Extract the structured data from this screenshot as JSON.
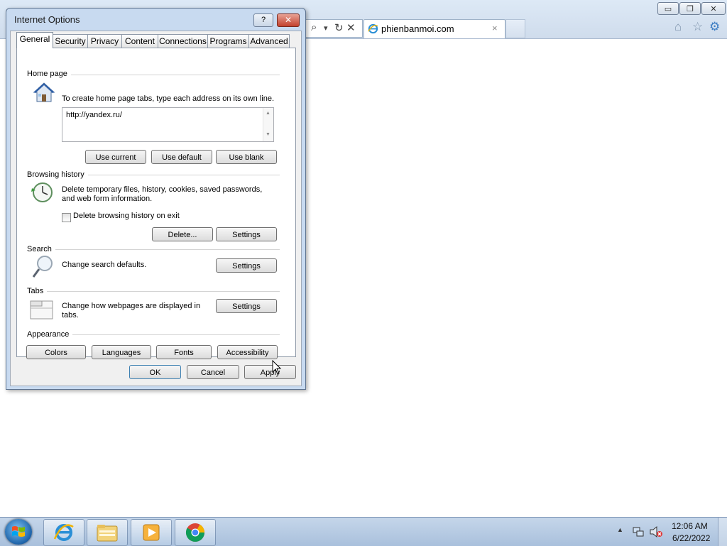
{
  "browser": {
    "tab_title": "phienbanmoi.com",
    "tab_close": "×",
    "window_buttons": {
      "minimize": "▭",
      "maximize": "❐",
      "close": "✕"
    },
    "address_icons": {
      "search": "⌕",
      "dropdown": "▾",
      "refresh": "↻",
      "stop": "✕"
    },
    "toolbar_icons": {
      "home": "⌂",
      "favorites": "☆",
      "tools": "⚙"
    }
  },
  "dialog": {
    "title": "Internet Options",
    "help_button": "?",
    "close_button": "✕",
    "tabs": [
      {
        "label": "General",
        "active": true
      },
      {
        "label": "Security"
      },
      {
        "label": "Privacy"
      },
      {
        "label": "Content"
      },
      {
        "label": "Connections"
      },
      {
        "label": "Programs"
      },
      {
        "label": "Advanced"
      }
    ],
    "home_page": {
      "title": "Home page",
      "description": "To create home page tabs, type each address on its own line.",
      "value": "http://yandex.ru/",
      "buttons": {
        "use_current": "Use current",
        "use_default": "Use default",
        "use_blank": "Use blank"
      }
    },
    "browsing_history": {
      "title": "Browsing history",
      "description_line1": "Delete temporary files, history, cookies, saved passwords,",
      "description_line2": "and web form information.",
      "checkbox_label": "Delete browsing history on exit",
      "checkbox_checked": false,
      "buttons": {
        "delete": "Delete...",
        "settings": "Settings"
      }
    },
    "search": {
      "title": "Search",
      "description": "Change search defaults.",
      "settings": "Settings"
    },
    "tabs_section": {
      "title": "Tabs",
      "description_line1": "Change how webpages are displayed in",
      "description_line2": "tabs.",
      "settings": "Settings"
    },
    "appearance": {
      "title": "Appearance",
      "buttons": {
        "colors": "Colors",
        "languages": "Languages",
        "fonts": "Fonts",
        "accessibility": "Accessibility"
      }
    },
    "footer": {
      "ok": "OK",
      "cancel": "Cancel",
      "apply": "Apply"
    }
  },
  "taskbar": {
    "pinned": [
      "internet-explorer",
      "windows-explorer",
      "media-player",
      "chrome"
    ],
    "tray_expand": "▲",
    "time": "12:06 AM",
    "date": "6/22/2022"
  },
  "colors": {
    "dialog_frame": "#c8daf0",
    "taskbar": "#b8cce4",
    "tab_ie_icon": "#2a8fd6"
  }
}
